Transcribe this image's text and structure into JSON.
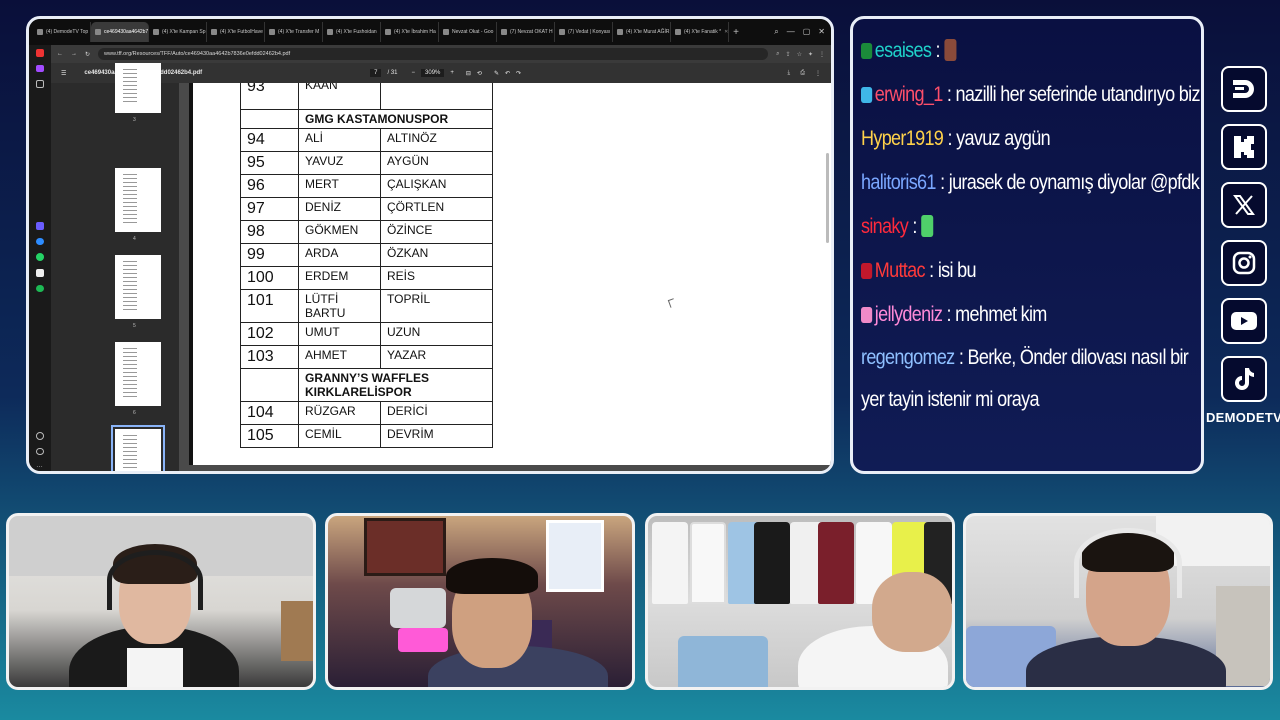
{
  "browser": {
    "tabs": [
      {
        "label": "(4) DemodeTV Top",
        "active": false
      },
      {
        "label": "ce469430aa4642b7836",
        "active": true
      },
      {
        "label": "(4) X'te Kampan Sp",
        "active": false
      },
      {
        "label": "(4) X'te FutbolHave",
        "active": false
      },
      {
        "label": "(4) X'te Transfer M",
        "active": false
      },
      {
        "label": "(4) X'te Fushoidan",
        "active": false
      },
      {
        "label": "(4) X'te İbrahim Ha",
        "active": false
      },
      {
        "label": "Nevzat Okat - Goo",
        "active": false
      },
      {
        "label": "(7) Nevzat OKAT H",
        "active": false
      },
      {
        "label": "(7) Vedat | Konyası",
        "active": false
      },
      {
        "label": "(4) X'te Murat AĞİR",
        "active": false
      },
      {
        "label": "(4) X'te Fanatik * ",
        "active": false
      }
    ],
    "url": "www.tff.org/Resources/TFF/Auto/ce469430aa4642b7836e0efdd02462b4.pdf",
    "pdf": {
      "filename": "ce469430aa4642b7836e0efdd02462b4.pdf",
      "page_current": "7",
      "page_total": "/ 31",
      "zoom": "309%"
    },
    "thumbnails": [
      "3",
      "4",
      "5",
      "6",
      "7"
    ],
    "roster": [
      {
        "type": "row",
        "num": "93",
        "first": "KAAN",
        "last": ""
      },
      {
        "type": "club",
        "name": "GMG KASTAMONUSPOR"
      },
      {
        "type": "row",
        "num": "94",
        "first": "ALİ",
        "last": "ALTINÖZ"
      },
      {
        "type": "row",
        "num": "95",
        "first": "YAVUZ",
        "last": "AYGÜN"
      },
      {
        "type": "row",
        "num": "96",
        "first": "MERT",
        "last": "ÇALIŞKAN"
      },
      {
        "type": "row",
        "num": "97",
        "first": "DENİZ",
        "last": "ÇÖRTLEN"
      },
      {
        "type": "row",
        "num": "98",
        "first": "GÖKMEN",
        "last": "ÖZİNCE"
      },
      {
        "type": "row",
        "num": "99",
        "first": "ARDA",
        "last": "ÖZKAN"
      },
      {
        "type": "row",
        "num": "100",
        "first": "ERDEM",
        "last": "REİS"
      },
      {
        "type": "row",
        "num": "101",
        "first": "LÜTFİ BARTU",
        "last": "TOPRİL"
      },
      {
        "type": "row",
        "num": "102",
        "first": "UMUT",
        "last": "UZUN"
      },
      {
        "type": "row",
        "num": "103",
        "first": "AHMET",
        "last": "YAZAR"
      },
      {
        "type": "club",
        "name": "GRANNY’S WAFFLES KIRKLARELİSPOR"
      },
      {
        "type": "row",
        "num": "104",
        "first": "RÜZGAR",
        "last": "DERİCİ"
      },
      {
        "type": "row",
        "num": "105",
        "first": "CEMİL",
        "last": "DEVRİM"
      }
    ]
  },
  "chat": {
    "messages": [
      {
        "user": "esaises",
        "text": "",
        "user_color": "#1fd1c9",
        "badge_color": "#1b8a3a",
        "emote": true
      },
      {
        "user": "erwing_1",
        "text": "nazilli her seferinde utandırıyo bizi",
        "user_color": "#ff4f6a",
        "badge_color": "#3fb6e8",
        "emote": false
      },
      {
        "user": "Hyper1919",
        "text": "yavuz aygün",
        "user_color": "#ffd24a",
        "badge_color": "",
        "emote": false
      },
      {
        "user": "halitoris61",
        "text": "jurasek de oynamış diyolar @pfdk",
        "user_color": "#7aa7ff",
        "badge_color": "",
        "emote": false
      },
      {
        "user": "sinaky",
        "text": "",
        "user_color": "#ff2a3c",
        "badge_color": "",
        "emote": true
      },
      {
        "user": "Muttac",
        "text": "isi bu",
        "user_color": "#ff3a3a",
        "badge_color": "#c0182c",
        "emote": false
      },
      {
        "user": "jellydeniz",
        "text": "mehmet kim",
        "user_color": "#ff8ad8",
        "badge_color": "#f08ac8",
        "emote": false
      },
      {
        "user": "regengomez",
        "text": "Berke, Önder dilovası nasıl bir yer tayin istenir mi oraya",
        "user_color": "#8fc0ff",
        "badge_color": "",
        "emote": false
      }
    ]
  },
  "socials": {
    "icons": [
      "demode-logo-icon",
      "kick-icon",
      "x-icon",
      "instagram-icon",
      "youtube-icon",
      "tiktok-icon"
    ],
    "brand": "DEMODETV"
  },
  "cams": [
    {
      "name": "webcam-1"
    },
    {
      "name": "webcam-2"
    },
    {
      "name": "webcam-3"
    },
    {
      "name": "webcam-4"
    }
  ]
}
